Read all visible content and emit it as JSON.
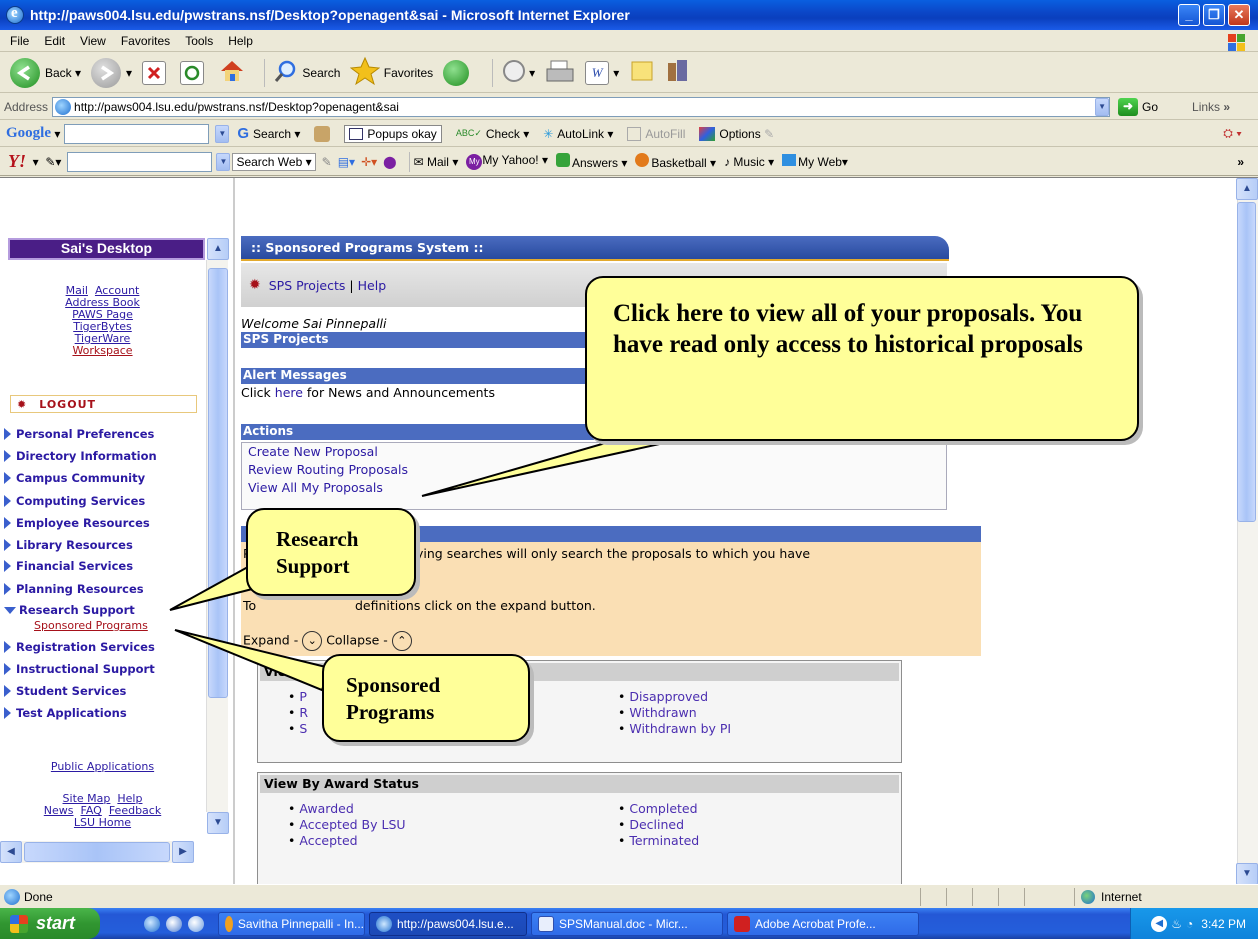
{
  "window": {
    "title": "http://paws004.lsu.edu/pwstrans.nsf/Desktop?openagent&sai - Microsoft Internet Explorer"
  },
  "menu": [
    "File",
    "Edit",
    "View",
    "Favorites",
    "Tools",
    "Help"
  ],
  "toolbar": {
    "back": "Back",
    "search": "Search",
    "favorites": "Favorites"
  },
  "address": {
    "label": "Address",
    "url": "http://paws004.lsu.edu/pwstrans.nsf/Desktop?openagent&sai",
    "go": "Go",
    "links": "Links"
  },
  "google": {
    "logo": "Google",
    "search": "Search",
    "popups": "Popups okay",
    "check": "Check",
    "autolink": "AutoLink",
    "autofill": "AutoFill",
    "options": "Options"
  },
  "yahoo": {
    "logo": "Y!",
    "search_web": "Search Web",
    "mail": "Mail",
    "my_yahoo": "My Yahoo!",
    "answers": "Answers",
    "basketball": "Basketball",
    "music": "Music",
    "my_web": "My Web"
  },
  "left": {
    "desktop_title": "Sai's Desktop",
    "mail": "Mail",
    "account": "Account",
    "address_book": "Address Book",
    "paws_page": "PAWS Page",
    "tigerbytes": "TigerBytes",
    "tigerware": "TigerWare",
    "workspace": "Workspace",
    "logout": "LOGOUT",
    "nav": [
      "Personal Preferences",
      "Directory Information",
      "Campus Community",
      "Computing Services",
      "Employee Resources",
      "Library Resources",
      "Financial Services",
      "Planning Resources",
      "Research Support",
      "Registration Services",
      "Instructional Support",
      "Student Services",
      "Test Applications"
    ],
    "sub_item": "Sponsored Programs",
    "public_apps": "Public Applications",
    "site_map": "Site Map",
    "help": "Help",
    "news": "News",
    "faq": "FAQ",
    "feedback": "Feedback",
    "lsu_home": "LSU Home"
  },
  "main": {
    "header": ":: Sponsored Programs System ::",
    "sps_projects_link": "SPS Projects",
    "pipe": "|",
    "help_link": "Help",
    "welcome": "Welcome Sai Pinnepalli",
    "sps_projects_bar": "SPS Projects",
    "alert_bar": "Alert Messages",
    "alert_pre": "Click ",
    "alert_link": "here",
    "alert_post": " for News and Announcements",
    "actions_bar": "Actions",
    "actions": [
      "Create New Proposal",
      "Review Routing Proposals",
      "View All My Proposals"
    ],
    "search_note_prefix": "P",
    "search_note": "ying searches will only search the proposals to which you have",
    "status_note_left": "To",
    "status_note": "definitions click on the expand button.",
    "expand": "Expand -",
    "collapse": "Collapse -",
    "view_header_partial": "Vie",
    "proposal_col1": [
      "P",
      "R",
      "S"
    ],
    "proposal_col2": [
      "Disapproved",
      "Withdrawn",
      "Withdrawn by PI"
    ],
    "award_header": "View By Award Status",
    "award_col1": [
      "Awarded",
      "Accepted By LSU",
      "Accepted"
    ],
    "award_col2": [
      "Completed",
      "Declined",
      "Terminated"
    ]
  },
  "callouts": {
    "proposals": "Click here to view all of your proposals. You have read only access to historical proposals",
    "research_1": "Research",
    "research_2": "Support",
    "sponsored_1": "Sponsored",
    "sponsored_2": "Programs"
  },
  "status": {
    "done": "Done",
    "zone": "Internet"
  },
  "taskbar": {
    "start": "start",
    "tasks": [
      "Savitha Pinnepalli - In...",
      "http://paws004.lsu.e...",
      "SPSManual.doc - Micr...",
      "Adobe Acrobat Profe..."
    ],
    "clock": "3:42 PM"
  }
}
